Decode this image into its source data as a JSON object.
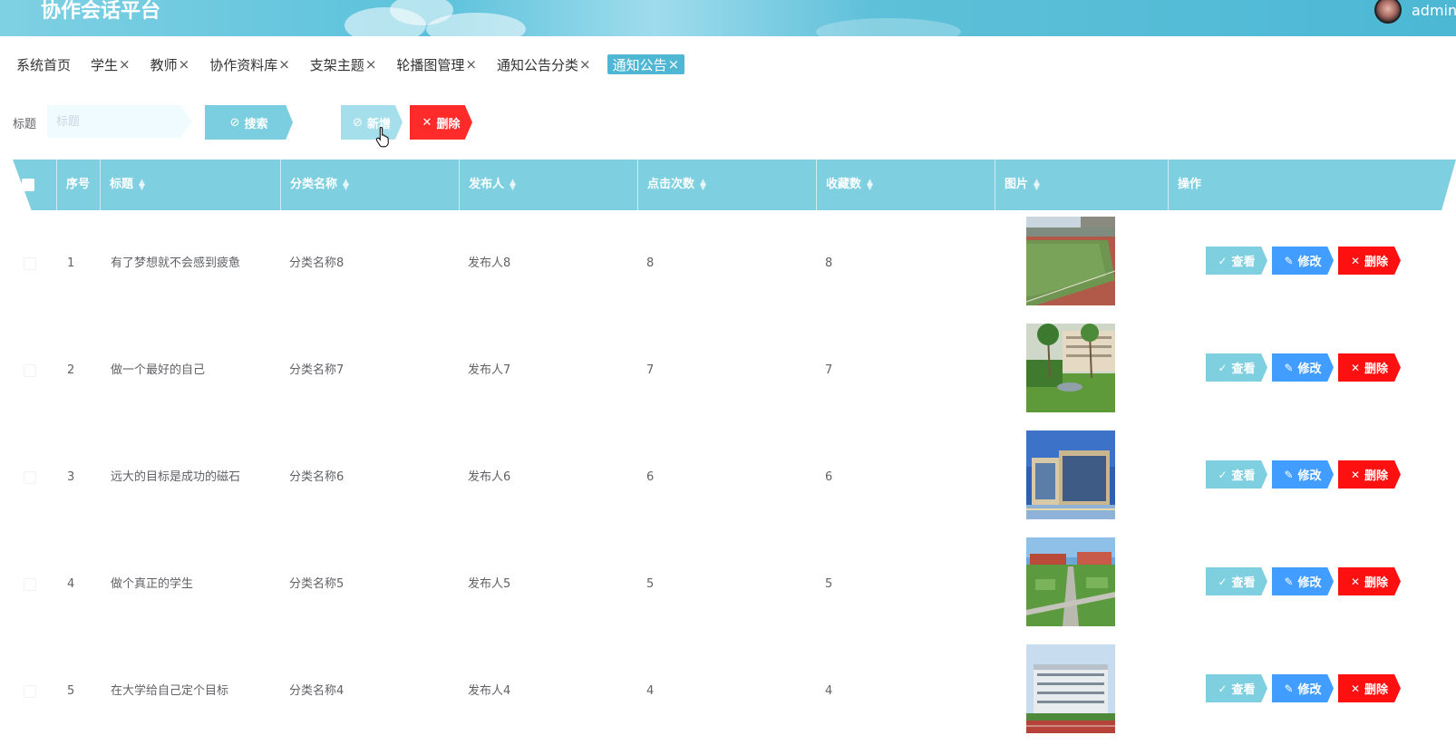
{
  "header": {
    "app_title": "协作会话平台",
    "user_name": "admin"
  },
  "tabs": [
    {
      "label": "系统首页",
      "closable": false
    },
    {
      "label": "学生",
      "closable": true
    },
    {
      "label": "教师",
      "closable": true
    },
    {
      "label": "协作资料库",
      "closable": true
    },
    {
      "label": "支架主题",
      "closable": true
    },
    {
      "label": "轮播图管理",
      "closable": true
    },
    {
      "label": "通知公告分类",
      "closable": true
    },
    {
      "label": "通知公告",
      "closable": true,
      "active": true
    }
  ],
  "tab_close_symbol": "×",
  "search": {
    "label": "标题",
    "placeholder": "标题",
    "value": ""
  },
  "toolbar": {
    "search_label": "搜索",
    "add_label": "新增",
    "delete_label": "删除"
  },
  "table": {
    "columns": [
      "序号",
      "标题",
      "分类名称",
      "发布人",
      "点击次数",
      "收藏数",
      "图片",
      "操作"
    ],
    "rows": [
      {
        "index": "1",
        "title": "有了梦想就不会感到疲惫",
        "category": "分类名称8",
        "publisher": "发布人8",
        "clicks": "8",
        "favorites": "8",
        "image": "stadium-track"
      },
      {
        "index": "2",
        "title": "做一个最好的自己",
        "category": "分类名称7",
        "publisher": "发布人7",
        "clicks": "7",
        "favorites": "7",
        "image": "palm-garden"
      },
      {
        "index": "3",
        "title": "远大的目标是成功的磁石",
        "category": "分类名称6",
        "publisher": "发布人6",
        "clicks": "6",
        "favorites": "6",
        "image": "blue-building"
      },
      {
        "index": "4",
        "title": "做个真正的学生",
        "category": "分类名称5",
        "publisher": "发布人5",
        "clicks": "5",
        "favorites": "5",
        "image": "campus-aerial"
      },
      {
        "index": "5",
        "title": "在大学给自己定个目标",
        "category": "分类名称4",
        "publisher": "发布人4",
        "clicks": "4",
        "favorites": "4",
        "image": "teaching-building"
      }
    ],
    "row_actions": {
      "view": "查看",
      "edit": "修改",
      "delete": "删除"
    }
  },
  "colors": {
    "header": "#5bc2db",
    "accent": "#7ecfe0",
    "active_tab": "#4fb7d3",
    "edit": "#419dff",
    "danger": "#ff1010"
  }
}
